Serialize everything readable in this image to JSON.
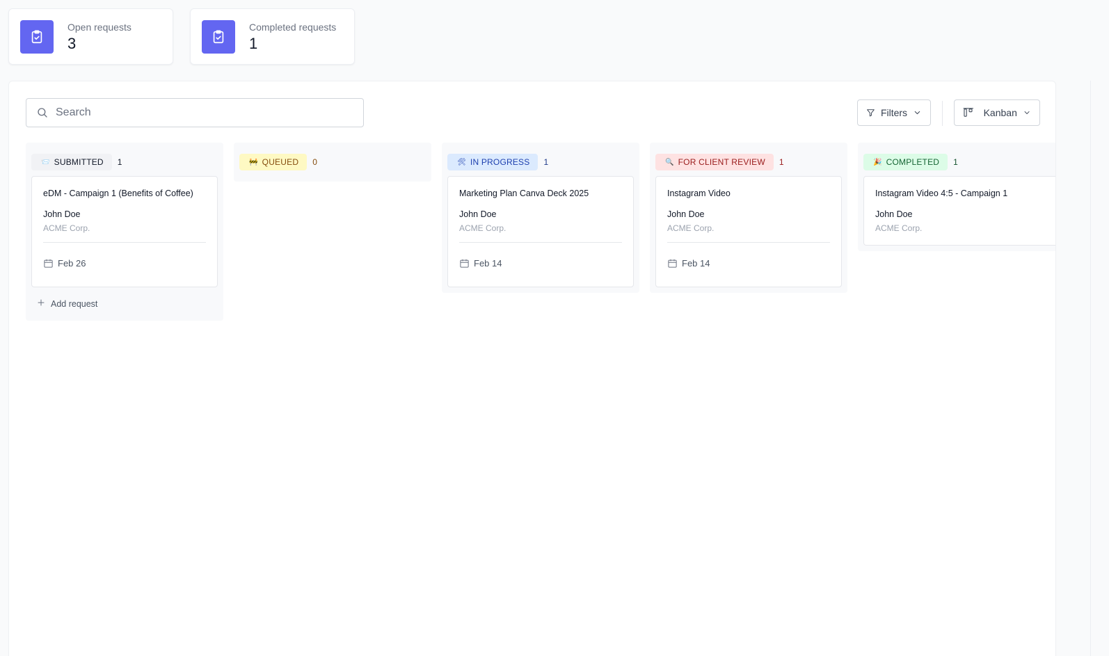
{
  "stats": [
    {
      "label": "Open requests",
      "value": "3",
      "icon": "clipboard-check-icon"
    },
    {
      "label": "Completed requests",
      "value": "1",
      "icon": "clipboard-check-icon"
    }
  ],
  "toolbar": {
    "search_placeholder": "Search",
    "filters_label": "Filters",
    "view_label": "Kanban"
  },
  "columns": [
    {
      "label": "SUBMITTED",
      "emoji": "📨",
      "count": "1",
      "bg": "#f1f2f5",
      "fg": "#111827",
      "count_color": "#111827",
      "cards": [
        {
          "title": "eDM - Campaign 1 (Benefits of Coffee)",
          "assignee": "John Doe",
          "company": "ACME Corp.",
          "date": "Feb 26"
        }
      ],
      "add_label": "Add request"
    },
    {
      "label": "QUEUED",
      "emoji": "🚧",
      "count": "0",
      "bg": "#fef9c3",
      "fg": "#854d0e",
      "count_color": "#854d0e",
      "cards": []
    },
    {
      "label": "IN PROGRESS",
      "emoji": "🛠",
      "count": "1",
      "bg": "#dbeafe",
      "fg": "#1e40af",
      "count_color": "#1e3a8a",
      "cards": [
        {
          "title": "Marketing Plan Canva Deck 2025",
          "assignee": "John Doe",
          "company": "ACME Corp.",
          "date": "Feb 14"
        }
      ]
    },
    {
      "label": "FOR CLIENT REVIEW",
      "emoji": "🔍",
      "count": "1",
      "bg": "#fee2e2",
      "fg": "#991b1b",
      "count_color": "#991b1b",
      "cards": [
        {
          "title": "Instagram Video",
          "assignee": "John Doe",
          "company": "ACME Corp.",
          "date": "Feb 14"
        }
      ]
    },
    {
      "label": "COMPLETED",
      "emoji": "🎉",
      "count": "1",
      "bg": "#dcfce7",
      "fg": "#166534",
      "count_color": "#14532d",
      "cards": [
        {
          "title": "Instagram Video 4:5 - Campaign 1",
          "assignee": "John Doe",
          "company": "ACME Corp."
        }
      ]
    }
  ]
}
